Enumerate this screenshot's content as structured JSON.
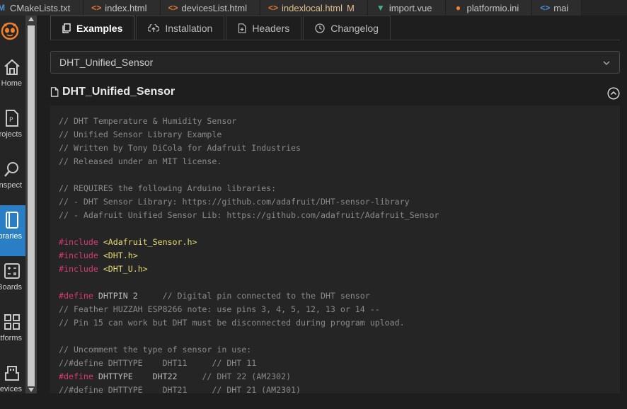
{
  "editor_tabs": [
    {
      "label": "CMakeLists.txt",
      "icon": "cmake-m-icon",
      "icon_glyph": "M",
      "icon_color": "#4a90d9",
      "modified": false
    },
    {
      "label": "index.html",
      "icon": "html-icon",
      "icon_glyph": "<>",
      "icon_color": "#e37933",
      "modified": false
    },
    {
      "label": "devicesList.html",
      "icon": "html-icon",
      "icon_glyph": "<>",
      "icon_color": "#e37933",
      "modified": false
    },
    {
      "label": "indexlocal.html",
      "icon": "html-icon",
      "icon_glyph": "<>",
      "icon_color": "#e37933",
      "modified": true,
      "flag": "M"
    },
    {
      "label": "import.vue",
      "icon": "vue-icon",
      "icon_glyph": "▼",
      "icon_color": "#41b883",
      "modified": false
    },
    {
      "label": "platformio.ini",
      "icon": "platformio-icon",
      "icon_glyph": "●",
      "icon_color": "#f5822a",
      "modified": false
    },
    {
      "label": "mai",
      "icon": "html-icon",
      "icon_glyph": "<>",
      "icon_color": "#4a90d9",
      "modified": false
    }
  ],
  "activity_bar": {
    "logo_icon": "platformio-alien-logo",
    "items": [
      {
        "label": "Home",
        "icon": "home-icon",
        "active": false
      },
      {
        "label": "Projects",
        "icon": "projects-icon",
        "active": false
      },
      {
        "label": "Inspect",
        "icon": "inspect-icon",
        "active": false
      },
      {
        "label": "Libraries",
        "icon": "libraries-icon",
        "active": true
      },
      {
        "label": "Boards",
        "icon": "boards-icon",
        "active": false
      },
      {
        "label": "Platforms",
        "icon": "platforms-icon",
        "active": false
      },
      {
        "label": "Devices",
        "icon": "devices-icon",
        "active": false
      }
    ]
  },
  "panel_tabs": [
    {
      "label": "Examples",
      "icon": "examples-icon",
      "active": true
    },
    {
      "label": "Installation",
      "icon": "installation-icon",
      "active": false
    },
    {
      "label": "Headers",
      "icon": "headers-icon",
      "active": false
    },
    {
      "label": "Changelog",
      "icon": "changelog-icon",
      "active": false
    }
  ],
  "example_select": {
    "value": "DHT_Unified_Sensor"
  },
  "section": {
    "title": "DHT_Unified_Sensor"
  },
  "code_lines": [
    [
      {
        "t": "// DHT Temperature & Humidity Sensor",
        "c": "c"
      }
    ],
    [
      {
        "t": "// Unified Sensor Library Example",
        "c": "c"
      }
    ],
    [
      {
        "t": "// Written by Tony DiCola for Adafruit Industries",
        "c": "c"
      }
    ],
    [
      {
        "t": "// Released under an MIT license.",
        "c": "c"
      }
    ],
    [],
    [
      {
        "t": "// REQUIRES the following Arduino libraries:",
        "c": "c"
      }
    ],
    [
      {
        "t": "// - DHT Sensor Library: https://github.com/adafruit/DHT-sensor-library",
        "c": "c"
      }
    ],
    [
      {
        "t": "// - Adafruit Unified Sensor Lib: https://github.com/adafruit/Adafruit_Sensor",
        "c": "c"
      }
    ],
    [],
    [
      {
        "t": "#include ",
        "c": "k"
      },
      {
        "t": "<Adafruit_Sensor.h>",
        "c": "s"
      }
    ],
    [
      {
        "t": "#include ",
        "c": "k"
      },
      {
        "t": "<DHT.h>",
        "c": "s"
      }
    ],
    [
      {
        "t": "#include ",
        "c": "k"
      },
      {
        "t": "<DHT_U.h>",
        "c": "s"
      }
    ],
    [],
    [
      {
        "t": "#define",
        "c": "k"
      },
      {
        "t": " DHTPIN 2     ",
        "c": "n"
      },
      {
        "t": "// Digital pin connected to the DHT sensor",
        "c": "c"
      }
    ],
    [
      {
        "t": "// Feather HUZZAH ESP8266 note: use pins 3, 4, 5, 12, 13 or 14 --",
        "c": "c"
      }
    ],
    [
      {
        "t": "// Pin 15 can work but DHT must be disconnected during program upload.",
        "c": "c"
      }
    ],
    [],
    [
      {
        "t": "// Uncomment the type of sensor in use:",
        "c": "c"
      }
    ],
    [
      {
        "t": "//#define DHTTYPE    DHT11     // DHT 11",
        "c": "c"
      }
    ],
    [
      {
        "t": "#define",
        "c": "k"
      },
      {
        "t": " DHTTYPE    DHT22     ",
        "c": "n"
      },
      {
        "t": "// DHT 22 (AM2302)",
        "c": "c"
      }
    ],
    [
      {
        "t": "//#define DHTTYPE    DHT21     // DHT 21 (AM2301)",
        "c": "c"
      }
    ]
  ]
}
